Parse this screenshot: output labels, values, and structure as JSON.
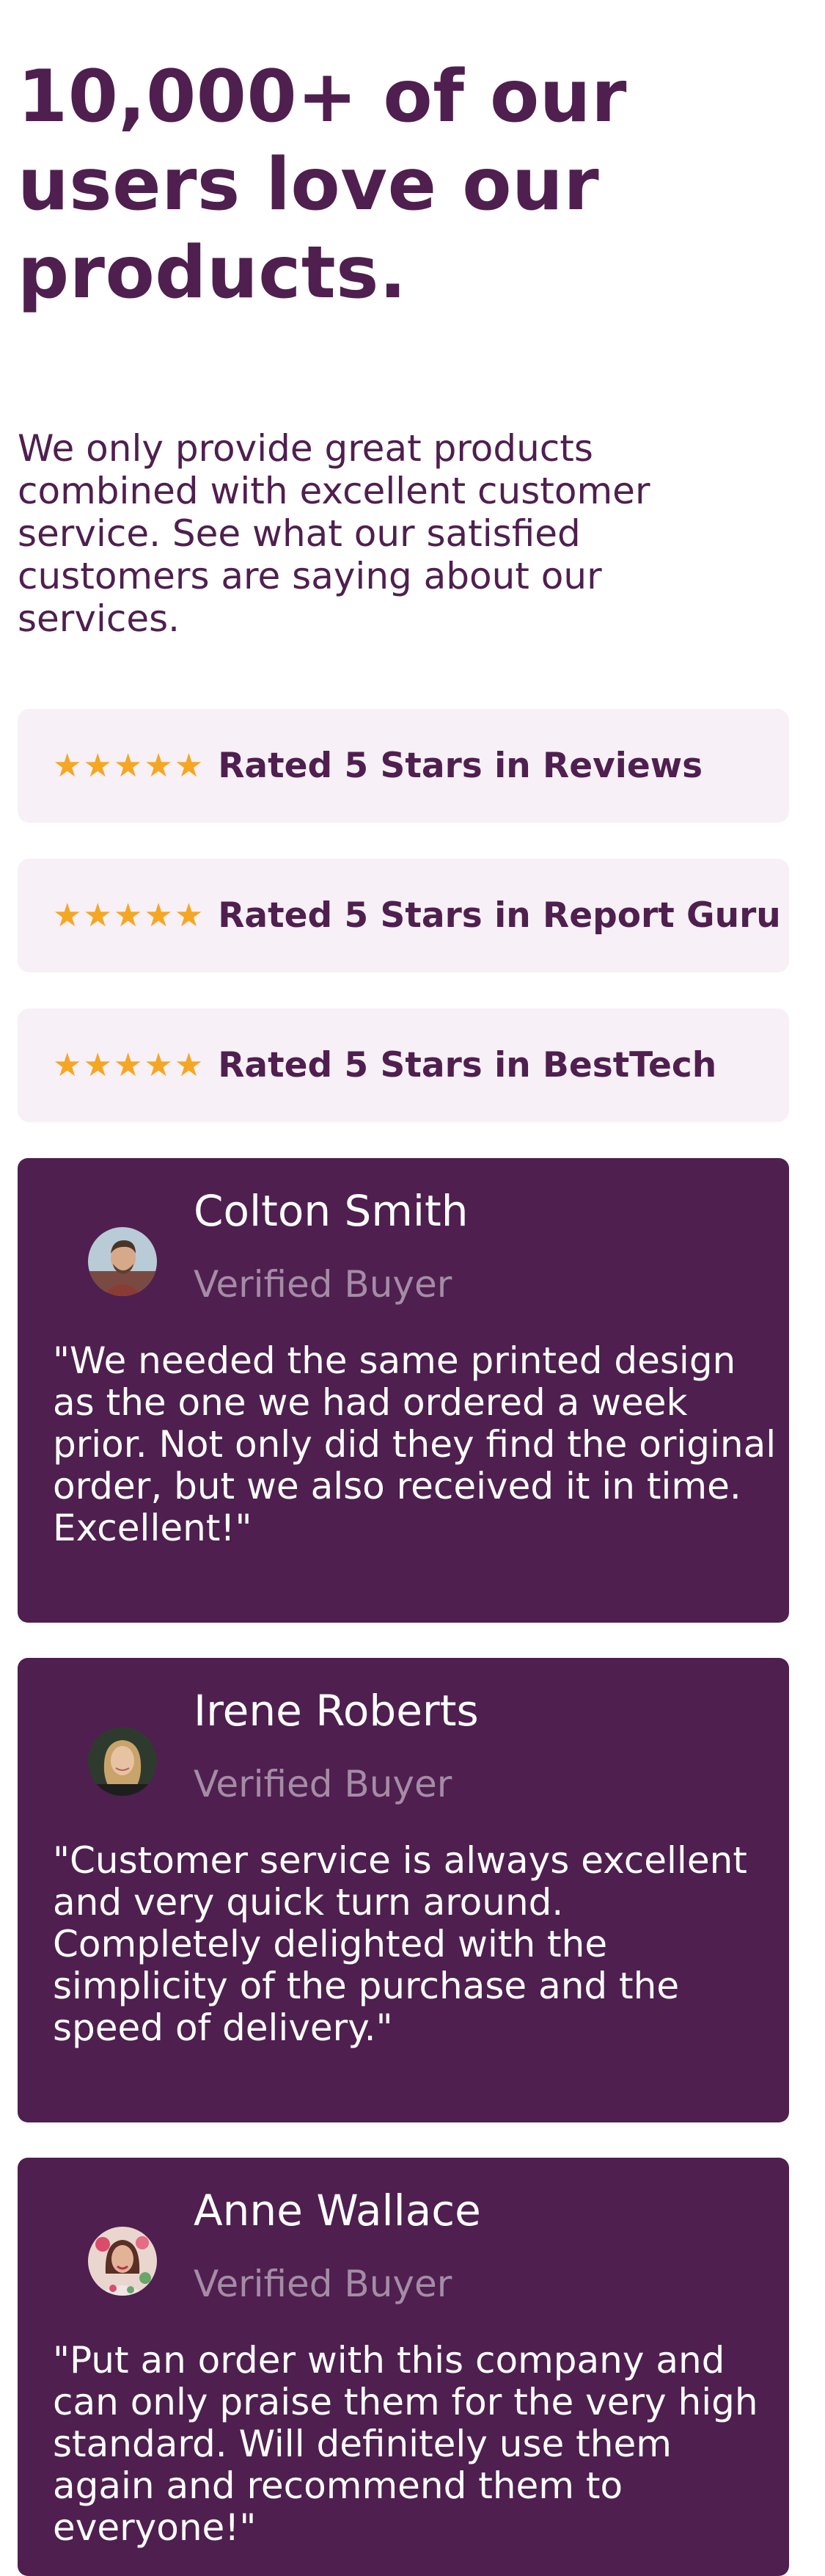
{
  "hero": {
    "headline": "10,000+ of our users love our products.",
    "intro": "We only provide great products combined with excellent customer service. See what our satisfied customers are saying about our services."
  },
  "ratings": [
    {
      "stars": "★★★★★",
      "stars_value": 5,
      "label": "Rated 5 Stars in Reviews"
    },
    {
      "stars": "★★★★★",
      "stars_value": 5,
      "label": "Rated 5 Stars in Report Guru"
    },
    {
      "stars": "★★★★★",
      "stars_value": 5,
      "label": "Rated 5 Stars in BestTech"
    }
  ],
  "testimonials": [
    {
      "name": "Colton Smith",
      "badge": "Verified Buyer",
      "quote": "\"We needed the same printed design as the one we had ordered a week prior. Not only did they find the original order, but we also received it in time. Excellent!\""
    },
    {
      "name": "Irene Roberts",
      "badge": "Verified Buyer",
      "quote": "\"Customer service is always excellent and very quick turn around. Completely delighted with the simplicity of the purchase and the speed of delivery.\""
    },
    {
      "name": "Anne Wallace",
      "badge": "Verified Buyer",
      "quote": "\"Put an order with this company and can only praise them for the very high standard. Will definitely use them again and recommend them to everyone!\""
    }
  ],
  "colors": {
    "brand": "#4f1f4f",
    "card_background": "#4e1f4f",
    "rating_background": "#f7f0f6",
    "star": "#f5a623",
    "badge_text": "#a58ca6"
  }
}
